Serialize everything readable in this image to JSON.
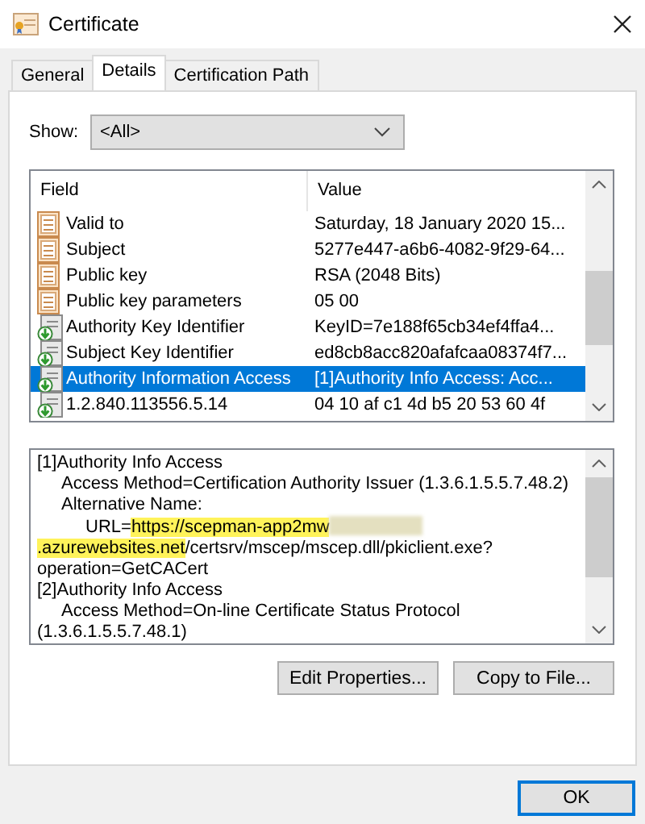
{
  "window": {
    "title": "Certificate"
  },
  "tabs": [
    {
      "label": "General",
      "selected": false
    },
    {
      "label": "Details",
      "selected": true
    },
    {
      "label": "Certification Path",
      "selected": false
    }
  ],
  "show": {
    "label": "Show:",
    "value": "<All>"
  },
  "fields_table": {
    "columns": [
      "Field",
      "Value"
    ],
    "rows": [
      {
        "kind": "basic",
        "field": "Valid to",
        "value": "Saturday, 18 January 2020 15...",
        "selected": false
      },
      {
        "kind": "basic",
        "field": "Subject",
        "value": "5277e447-a6b6-4082-9f29-64...",
        "selected": false
      },
      {
        "kind": "basic",
        "field": "Public key",
        "value": "RSA (2048 Bits)",
        "selected": false
      },
      {
        "kind": "basic",
        "field": "Public key parameters",
        "value": "05 00",
        "selected": false
      },
      {
        "kind": "extension",
        "field": "Authority Key Identifier",
        "value": "KeyID=7e188f65cb34ef4ffa4...",
        "selected": false
      },
      {
        "kind": "extension",
        "field": "Subject Key Identifier",
        "value": "ed8cb8acc820afafcaa08374f7...",
        "selected": false
      },
      {
        "kind": "extension",
        "field": "Authority Information Access",
        "value": "[1]Authority Info Access: Acc...",
        "selected": true
      },
      {
        "kind": "extension",
        "field": "1.2.840.113556.5.14",
        "value": "04 10 af c1 4d b5 20 53 60 4f",
        "selected": false
      }
    ]
  },
  "details": [
    {
      "kind": "text",
      "text": "[1]Authority Info Access",
      "children": [
        {
          "kind": "text",
          "text": "Access Method=Certification Authority Issuer (1.3.6.1.5.5.7.48.2)"
        },
        {
          "kind": "text",
          "text": "Alternative Name:",
          "children": [
            {
              "kind": "url",
              "label": "URL=",
              "highlight_start": "https://scepman-app2mw",
              "redacted": true,
              "highlight_end": ".azurewebsites.net",
              "rest": "/certsrv/mscep/mscep.dll/pkiclient.exe?operation=GetCACert"
            }
          ]
        }
      ]
    },
    {
      "kind": "text",
      "text": "[2]Authority Info Access",
      "children": [
        {
          "kind": "text",
          "text": "Access Method=On-line Certificate Status Protocol (1.3.6.1.5.5.7.48.1)"
        }
      ]
    }
  ],
  "buttons": [
    "Edit Properties...",
    "Copy to File..."
  ],
  "ok_button": "OK"
}
